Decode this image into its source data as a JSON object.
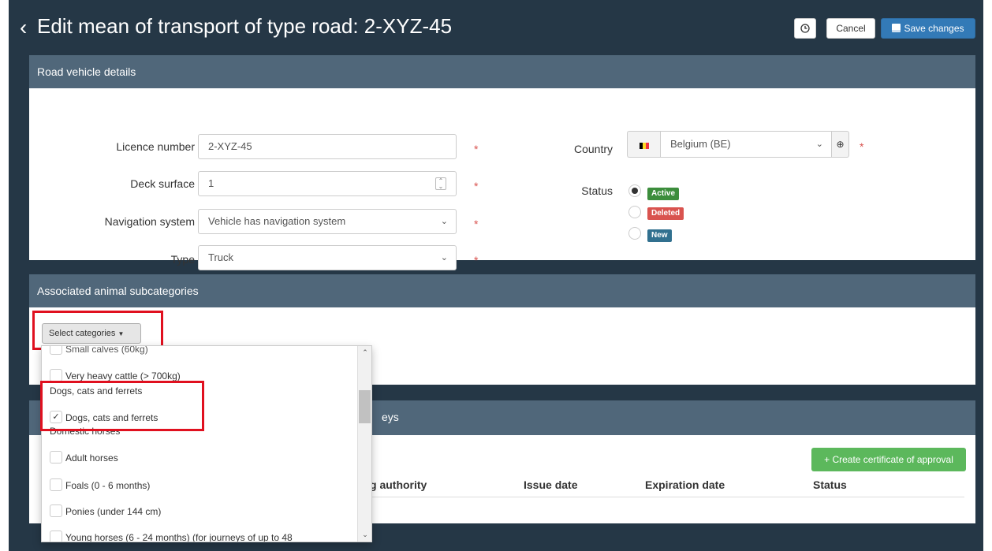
{
  "header": {
    "title": "Edit mean of transport of type road: 2-XYZ-45",
    "history_icon": "clock-icon",
    "cancel_label": "Cancel",
    "save_label": "Save changes"
  },
  "vehicle": {
    "heading": "Road vehicle details",
    "licence_label": "Licence number",
    "licence_value": "2-XYZ-45",
    "deck_label": "Deck surface",
    "deck_value": "1",
    "nav_label": "Navigation system",
    "nav_value": "Vehicle has navigation system",
    "type_label": "Type",
    "type_value": "Truck",
    "country_label": "Country",
    "country_value": "Belgium (BE)",
    "status_label": "Status",
    "statuses": [
      {
        "label": "Active",
        "color": "#3c8d3c",
        "checked": true
      },
      {
        "label": "Deleted",
        "color": "#d9534f",
        "checked": false
      },
      {
        "label": "New",
        "color": "#31708f",
        "checked": false
      }
    ],
    "required_marker": "*"
  },
  "subcategories": {
    "heading": "Associated animal subcategories",
    "select_label": "Select categories",
    "dropdown": {
      "cut_top": "Small calves (60kg)",
      "items": [
        {
          "kind": "option",
          "label": "Very heavy cattle (> 700kg)",
          "checked": false
        },
        {
          "kind": "group",
          "label": "Dogs, cats and ferrets"
        },
        {
          "kind": "option",
          "label": "Dogs, cats and ferrets",
          "checked": true
        },
        {
          "kind": "group",
          "label": "Domestic horses"
        },
        {
          "kind": "option",
          "label": "Adult horses",
          "checked": false
        },
        {
          "kind": "option",
          "label": "Foals (0 - 6 months)",
          "checked": false
        },
        {
          "kind": "option",
          "label": "Ponies (under 144 cm)",
          "checked": false
        },
        {
          "kind": "option",
          "label": "Young horses (6 - 24 months) (for journeys of up to 48",
          "checked": false
        }
      ]
    }
  },
  "certificates": {
    "heading_fragment": "eys",
    "create_label": "+ Create certificate of approval",
    "columns": [
      "g authority",
      "Issue date",
      "Expiration date",
      "Status"
    ]
  }
}
